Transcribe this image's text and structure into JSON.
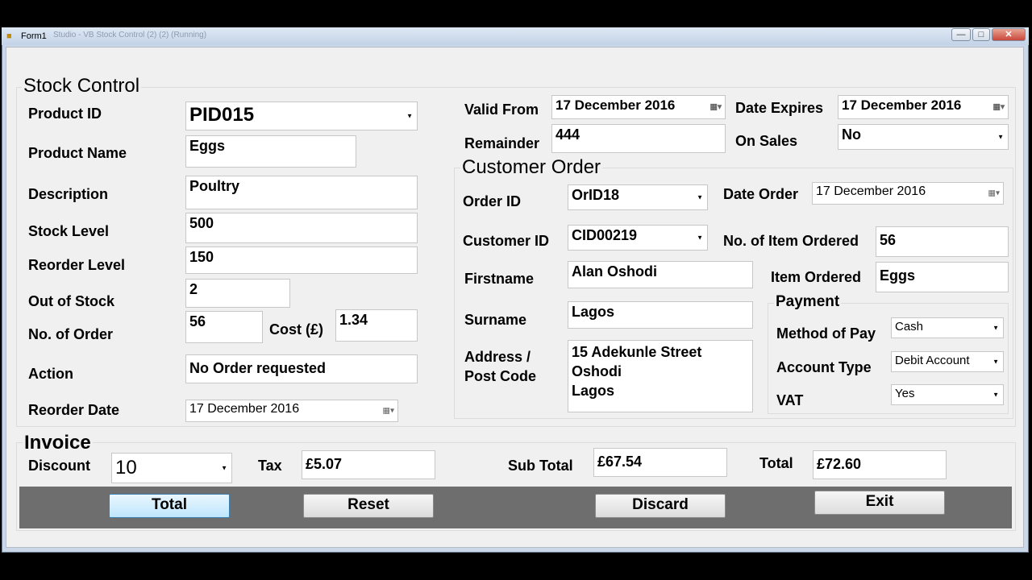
{
  "window": {
    "title": "Form1",
    "faded_title": "Studio - VB Stock Control (2) (2) (Running)",
    "minimize_glyph": "—",
    "maximize_glyph": "□",
    "close_glyph": "✕"
  },
  "stock_control": {
    "title": "Stock Control",
    "product_id": {
      "label": "Product ID",
      "value": "PID015"
    },
    "product_name": {
      "label": "Product Name",
      "value": "Eggs"
    },
    "description": {
      "label": "Description",
      "value": "Poultry"
    },
    "stock_level": {
      "label": "Stock Level",
      "value": "500"
    },
    "reorder_level": {
      "label": "Reorder Level",
      "value": "150"
    },
    "out_of_stock": {
      "label": "Out of Stock",
      "value": "2"
    },
    "no_of_order": {
      "label": "No. of Order",
      "value": "56"
    },
    "cost": {
      "label": "Cost (£)",
      "value": "1.34"
    },
    "action": {
      "label": "Action",
      "value": "No Order requested"
    },
    "reorder_date": {
      "label": "Reorder Date",
      "value": "17 December 2016"
    },
    "valid_from": {
      "label": "Valid From",
      "value": "17 December  2016"
    },
    "date_expires": {
      "label": "Date Expires",
      "value": "17 December  2016"
    },
    "remainder": {
      "label": "Remainder",
      "value": "444"
    },
    "on_sales": {
      "label": "On Sales",
      "value": "No"
    }
  },
  "customer_order": {
    "title": "Customer Order",
    "order_id": {
      "label": "Order ID",
      "value": "OrID18"
    },
    "date_order": {
      "label": "Date Order",
      "value": "17 December 2016"
    },
    "customer_id": {
      "label": "Customer ID",
      "value": "CID00219"
    },
    "no_items_ordered": {
      "label": "No. of Item Ordered",
      "value": "56"
    },
    "firstname": {
      "label": "Firstname",
      "value": "Alan Oshodi"
    },
    "item_ordered": {
      "label": "Item Ordered",
      "value": "Eggs"
    },
    "surname": {
      "label": "Surname",
      "value": "Lagos"
    },
    "address": {
      "label_line1": "Address /",
      "label_line2": "Post Code",
      "value": "15 Adekunle Street\nOshodi\nLagos"
    },
    "payment": {
      "title": "Payment",
      "method_of_pay": {
        "label": "Method of Pay",
        "value": "Cash"
      },
      "account_type": {
        "label": "Account Type",
        "value": "Debit Account"
      },
      "vat": {
        "label": "VAT",
        "value": "Yes"
      }
    }
  },
  "invoice": {
    "title": "Invoice",
    "discount": {
      "label": "Discount",
      "value": "10"
    },
    "tax": {
      "label": "Tax",
      "value": "£5.07"
    },
    "sub_total": {
      "label": "Sub Total",
      "value": "£67.54"
    },
    "total": {
      "label": "Total",
      "value": "£72.60"
    }
  },
  "buttons": {
    "total": "Total",
    "reset": "Reset",
    "discard": "Discard",
    "exit": "Exit"
  },
  "icons": {
    "dropdown_arrow": "▼",
    "calendar": "▦▾"
  }
}
